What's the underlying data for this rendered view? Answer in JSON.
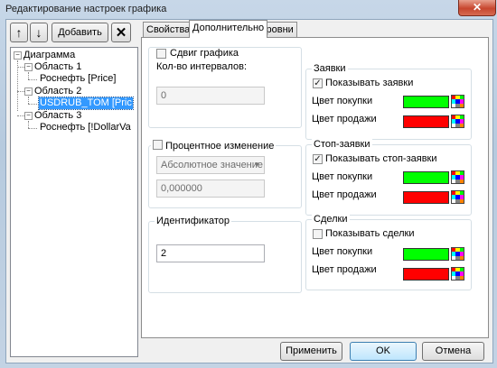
{
  "window": {
    "title": "Редактирование настроек графика",
    "close_glyph": "✕"
  },
  "toolbar": {
    "up_glyph": "↑",
    "down_glyph": "↓",
    "add_label": "Добавить",
    "delete_glyph": "✕"
  },
  "tree": {
    "root": "Диаграмма",
    "area1": "Область 1",
    "area1_item": "Роснефть [Price]",
    "area2": "Область 2",
    "area2_item": "USDRUB_TOM [Pric",
    "area3": "Область 3",
    "area3_item": "Роснефть [!DollarVa"
  },
  "tabs": {
    "properties": "Свойства",
    "extra": "Дополнительно",
    "levels": "Уровни"
  },
  "shift": {
    "label": "Сдвиг графика",
    "checked": false,
    "intervals_label": "Кол-во интервалов:",
    "intervals_value": "0"
  },
  "percent": {
    "label": "Процентное изменение",
    "checked": false,
    "mode_value": "Абсолютное значение",
    "value": "0,000000"
  },
  "identifier": {
    "label": "Идентификатор",
    "value": "2"
  },
  "orders": {
    "title": "Заявки",
    "show_label": "Показывать заявки",
    "checked": true,
    "buy_label": "Цвет покупки",
    "sell_label": "Цвет продажи",
    "buy_color": "#00ff00",
    "sell_color": "#ff0000"
  },
  "stop_orders": {
    "title": "Стоп-заявки",
    "show_label": "Показывать стоп-заявки",
    "checked": true,
    "buy_label": "Цвет покупки",
    "sell_label": "Цвет продажи",
    "buy_color": "#00ff00",
    "sell_color": "#ff0000"
  },
  "trades": {
    "title": "Сделки",
    "show_label": "Показывать сделки",
    "checked": false,
    "buy_label": "Цвет покупки",
    "sell_label": "Цвет продажи",
    "buy_color": "#00ff00",
    "sell_color": "#ff0000"
  },
  "buttons": {
    "apply": "Применить",
    "ok": "OK",
    "cancel": "Отмена"
  },
  "colors": {
    "selection": "#3399ff",
    "check_glyph": "✓"
  }
}
